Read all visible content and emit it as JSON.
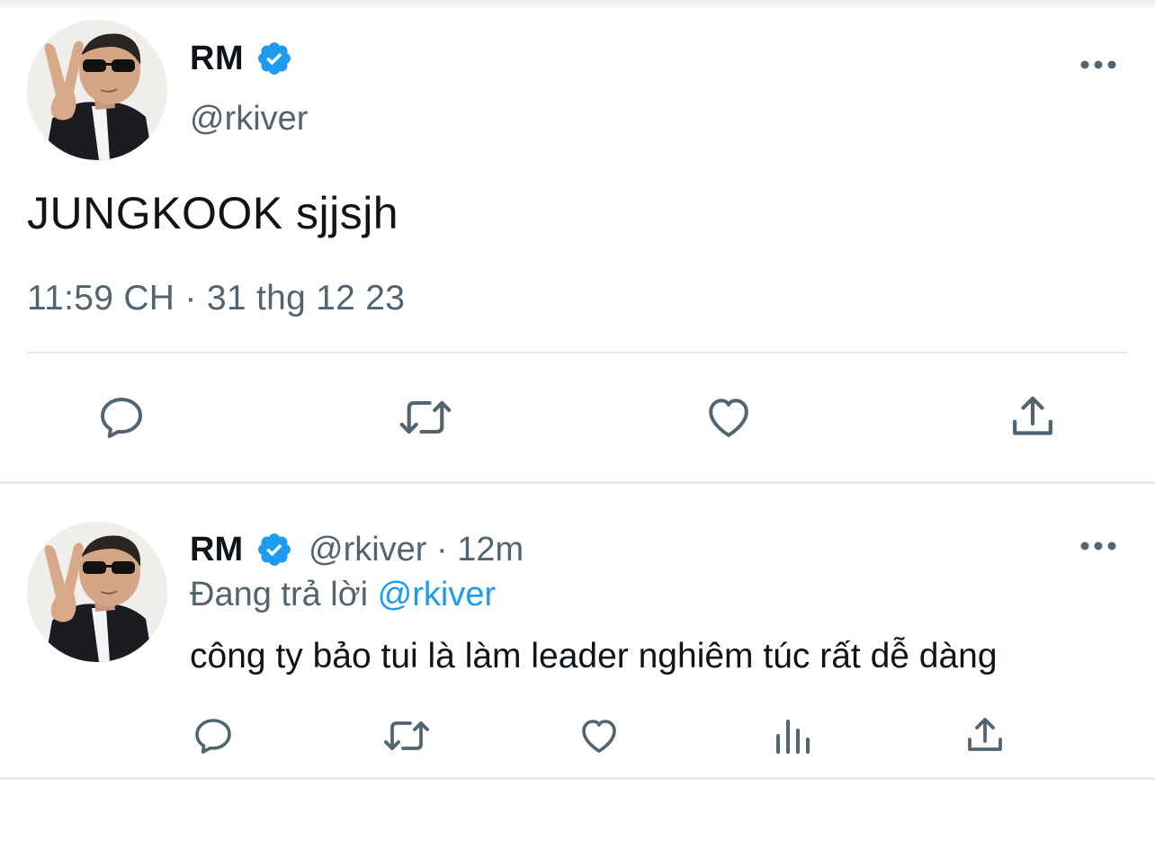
{
  "colors": {
    "text_primary": "#0f1419",
    "text_secondary": "#536471",
    "link_blue": "#1d9bf0",
    "verified_blue": "#1d9bf0",
    "icon_gray": "#536471",
    "divider": "#e7e9ea"
  },
  "main_tweet": {
    "display_name": "RM",
    "handle": "@rkiver",
    "text": "JUNGKOOK sjjsjh",
    "timestamp": "11:59 CH · 31 thg 12 23",
    "avatar_icon": "user-avatar-photo",
    "actions": [
      {
        "name": "reply",
        "icon": "reply-icon"
      },
      {
        "name": "retweet",
        "icon": "retweet-icon"
      },
      {
        "name": "like",
        "icon": "heart-icon"
      },
      {
        "name": "share",
        "icon": "share-icon"
      }
    ]
  },
  "reply_tweet": {
    "display_name": "RM",
    "meta": "@rkiver · 12m",
    "replying_prefix": "Đang trả lời ",
    "replying_mention": "@rkiver",
    "text": "công ty bảo tui là làm leader nghiêm túc rất dễ dàng",
    "actions": [
      {
        "name": "reply",
        "icon": "reply-icon"
      },
      {
        "name": "retweet",
        "icon": "retweet-icon"
      },
      {
        "name": "like",
        "icon": "heart-icon"
      },
      {
        "name": "views",
        "icon": "analytics-icon"
      },
      {
        "name": "share",
        "icon": "share-icon"
      }
    ]
  }
}
